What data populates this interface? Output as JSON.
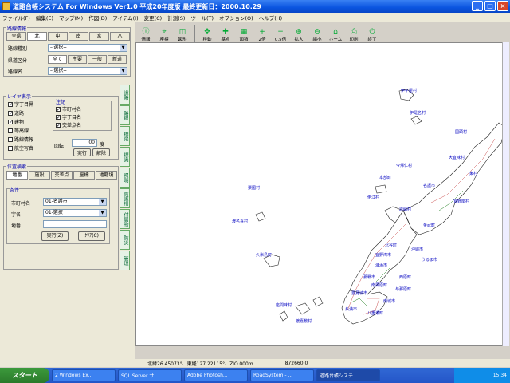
{
  "window": {
    "title": "道路台帳システム For Windows Ver1.0 平成20年度版 最終更新日：2000.10.29"
  },
  "menu": [
    "ファイル(F)",
    "編集(E)",
    "マップ(M)",
    "作図(D)",
    "アイテム(I)",
    "変更(C)",
    "計測(S)",
    "ツール(T)",
    "オプション(O)",
    "ヘルプ(H)"
  ],
  "toolbar": [
    {
      "label": "情報",
      "icon": "info-icon"
    },
    {
      "label": "座標",
      "icon": "coordinate-icon"
    },
    {
      "label": "図形",
      "icon": "shape-icon"
    },
    {
      "label": "",
      "icon": "separator"
    },
    {
      "label": "移動",
      "icon": "move-icon"
    },
    {
      "label": "基点",
      "icon": "base-point-icon"
    },
    {
      "label": "面積",
      "icon": "area-icon"
    },
    {
      "label": "2倍",
      "icon": "zoom-2x-icon"
    },
    {
      "label": "0.5倍",
      "icon": "zoom-half-icon"
    },
    {
      "label": "拡大",
      "icon": "zoom-in-icon"
    },
    {
      "label": "縮小",
      "icon": "zoom-out-icon"
    },
    {
      "label": "ホーム",
      "icon": "home-icon"
    },
    {
      "label": "印刷",
      "icon": "print-icon"
    },
    {
      "label": "終了",
      "icon": "exit-icon"
    }
  ],
  "left": {
    "road_info_title": "路線情報",
    "area_tabs": [
      "全県",
      "北",
      "中",
      "南",
      "宮",
      "八"
    ],
    "road_type_label": "路線種別",
    "road_type_value": "--選択--",
    "class_label": "県道区分",
    "class_tabs": [
      "全て",
      "主要",
      "一般",
      "新道"
    ],
    "road_name_label": "路線名",
    "road_name_value": "--選択--",
    "layer_title": "レイヤ表示",
    "layers": [
      {
        "label": "字丁目界",
        "checked": true
      },
      {
        "label": "道路",
        "checked": true
      },
      {
        "label": "建物",
        "checked": true
      },
      {
        "label": "等高線",
        "checked": false
      },
      {
        "label": "路線情報",
        "checked": false
      },
      {
        "label": "航空写真",
        "checked": false
      }
    ],
    "annot_title": "注記",
    "annots": [
      {
        "label": "市町村名",
        "checked": true
      },
      {
        "label": "字丁目名",
        "checked": true
      },
      {
        "label": "交差点名",
        "checked": true
      }
    ],
    "rotate_label": "回転",
    "rotate_value": "00",
    "rotate_unit": "度",
    "exec_label": "実行",
    "reset_label": "解除",
    "search_title": "位置検索",
    "search_tabs": [
      "地番",
      "施設",
      "交差点",
      "座標",
      "地籍境"
    ],
    "cond_title": "条件",
    "city_label": "市町村名",
    "city_value": "01-名護市",
    "aza_label": "字名",
    "aza_value": "01-選択",
    "chiban_label": "地番",
    "run_label": "実行(Z)",
    "clear_label": "ｸﾘｱ(C)",
    "side_tabs": [
      "道路",
      "路線",
      "橋梁",
      "標識",
      "照明",
      "防護柵",
      "付属物",
      "防災",
      "管理"
    ]
  },
  "map": {
    "labels": [
      "伊平屋村",
      "伊是名村",
      "国頭村",
      "大宜味村",
      "東村",
      "今帰仁村",
      "本部町",
      "名護市",
      "宜野座村",
      "恩納村",
      "金武町",
      "伊江村",
      "粟国村",
      "渡名喜村",
      "久米島町",
      "北谷町",
      "沖縄市",
      "うるま市",
      "宜野湾市",
      "浦添市",
      "那覇市",
      "南風原町",
      "西原町",
      "与那原町",
      "豊見城市",
      "糸満市",
      "南城市",
      "八重瀬町",
      "渡嘉敷村",
      "座間味村"
    ]
  },
  "status": {
    "coords": "北緯26.45073°、東経127.22115°、ZIO.000m",
    "scale": "872660.0"
  },
  "taskbar": {
    "start": "スタート",
    "tasks": [
      "2 Windows Ex...",
      "SQL Server サ...",
      "Adobe Photosh...",
      "RoadSystem - ...",
      "道路台帳システ..."
    ],
    "clock": "15:34"
  }
}
